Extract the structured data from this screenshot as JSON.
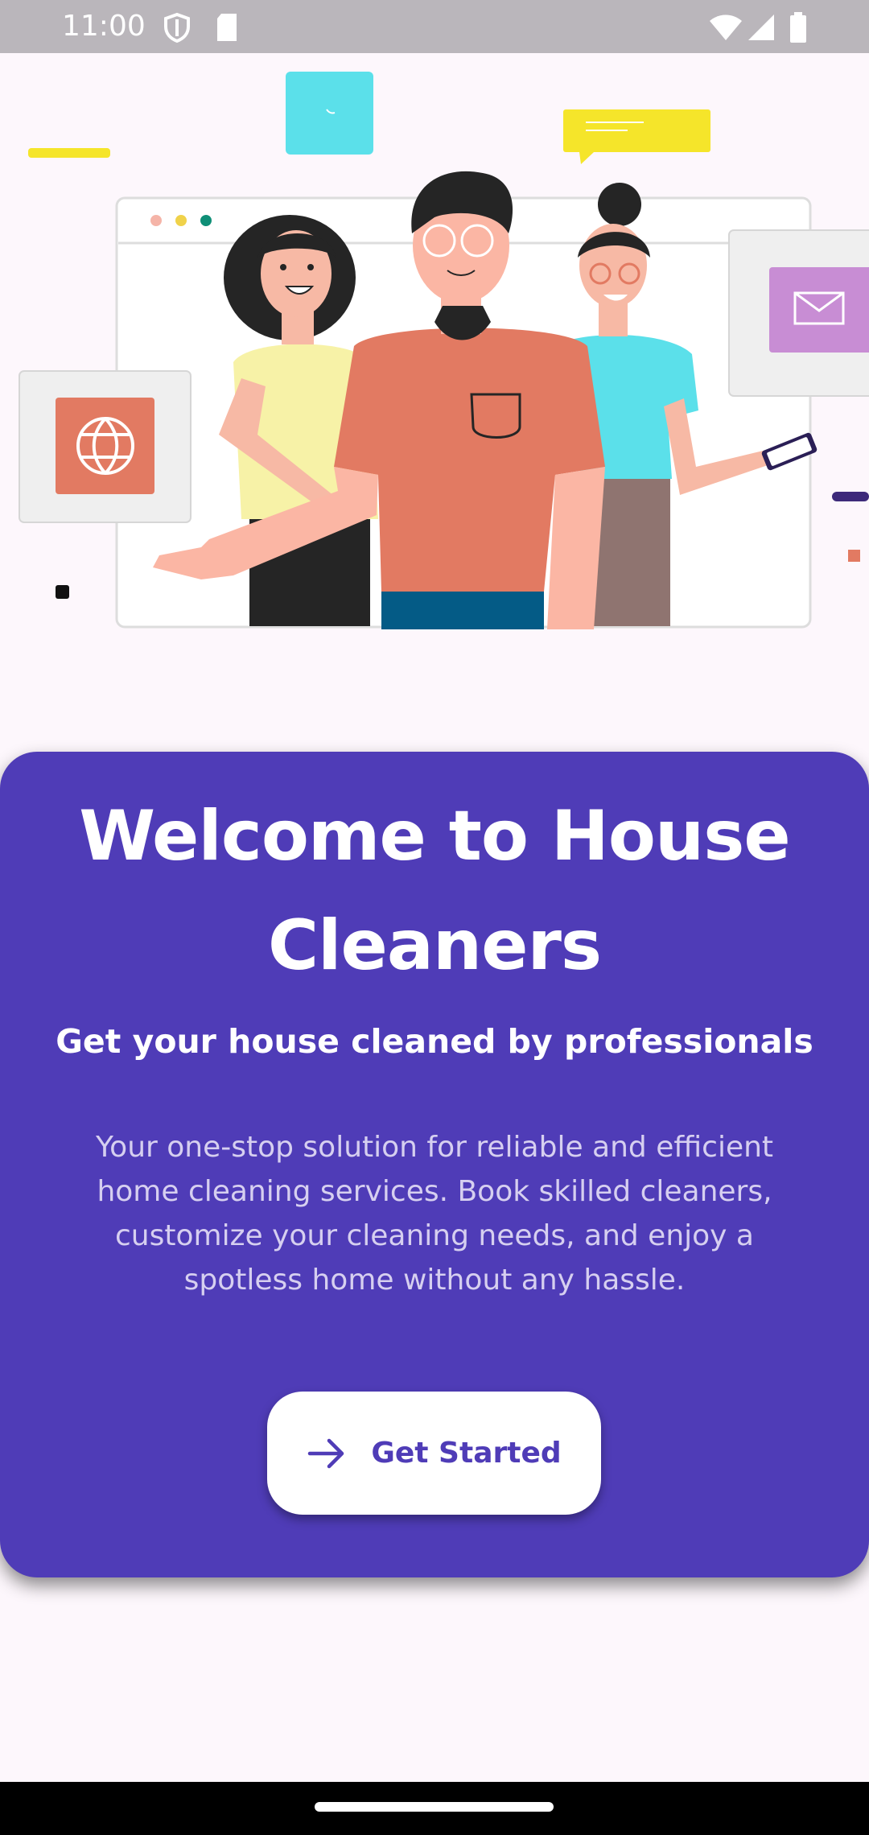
{
  "status_bar": {
    "time": "11:00",
    "icons": [
      "shield-icon",
      "sd-card-icon",
      "wifi-icon",
      "cellular-signal-icon",
      "battery-icon"
    ]
  },
  "illustration": {
    "description_icons": [
      "phone-icon",
      "chat-bubble-icon",
      "globe-icon",
      "mail-icon",
      "smartphone-icon"
    ]
  },
  "welcome": {
    "title": "Welcome to House Cleaners",
    "subtitle": "Get your house cleaned by professionals",
    "description": "Your one-stop solution for reliable and efficient home cleaning services. Book skilled cleaners, customize your cleaning needs, and enjoy a spotless home without any hassle."
  },
  "cta": {
    "label": "Get Started",
    "icon": "arrow-right-icon"
  },
  "colors": {
    "primary": "#4f3cb7",
    "background": "#fdf7fc",
    "accent_yellow": "#f5e52a",
    "accent_cyan": "#5be0ea",
    "accent_coral": "#e27a62",
    "accent_lilac": "#c88dd4"
  }
}
